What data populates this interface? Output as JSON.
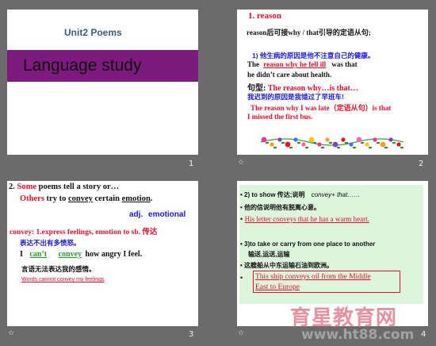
{
  "slides": {
    "s1": {
      "number": "1",
      "title": "Unit2  Poems",
      "banner": "Language study"
    },
    "s2": {
      "number": "2",
      "star": "☆",
      "heading": "1. reason",
      "intro": "reason后可接why / that引导的定语从句;",
      "ex1_cn": "1) 他生病的原因是他不注意自己的健康。",
      "ex1_the": "The",
      "ex1_blank": "reason   why   he   fell   ill",
      "ex1_tail": "was that",
      "ex1_line2": "he didn’t care about health.",
      "pattern_label": "句型:",
      "pattern_text": "The reason why…is that…",
      "ex2_cn": "我迟到的原因是我错过了早班车!",
      "ex2_line1": "The reason why I was late（定语从句）is that",
      "ex2_line2": "I missed the first bus."
    },
    "s3": {
      "number": "3",
      "star": "☆",
      "l1_num": "2.",
      "l1_some": "Some",
      "l1_rest": "poems tell a story or…",
      "l2_others": "Others",
      "l2_rest1": "try to",
      "l2_convey": "convey",
      "l2_rest2": "certain",
      "l2_emotion": "emotion",
      "l2_dot": ".",
      "adj": "adj.",
      "emotional": "emotional",
      "def": "convey: 1.express feelings, emotion to sb. 传达",
      "cn1": "表达不出有多愤怒。",
      "i_word": "I",
      "blank1": "can’t",
      "blank2": "convey",
      "tail": "how angry I feel.",
      "cn2": "言语无法表达我的感情。",
      "small": "Words cannot convey my feelings"
    },
    "s4": {
      "number": "4",
      "star": "☆",
      "b1_a": "2) to show 传达;说明",
      "b1_b": "convey+ that……",
      "b2": "他的信说明他有脱离心意。",
      "b3": "His letter conveys that he has a warm heart.",
      "b4": "3)to take or carry from one place to another",
      "b4_cn": "输送,运送,运输",
      "b5": "这艘船从中东运输石油到欧洲。",
      "b6_l1": "This ship conveys  oil from the Middle",
      "b6_l2": "East to Europe"
    }
  },
  "watermark": {
    "cn": "育星教育网",
    "url": "www.ht88.com"
  },
  "colors": {
    "banner": "#7d1a7d",
    "accent_red": "#e8102a",
    "accent_blue": "#1a1adf",
    "highlight_green": "#dcf5dc"
  }
}
